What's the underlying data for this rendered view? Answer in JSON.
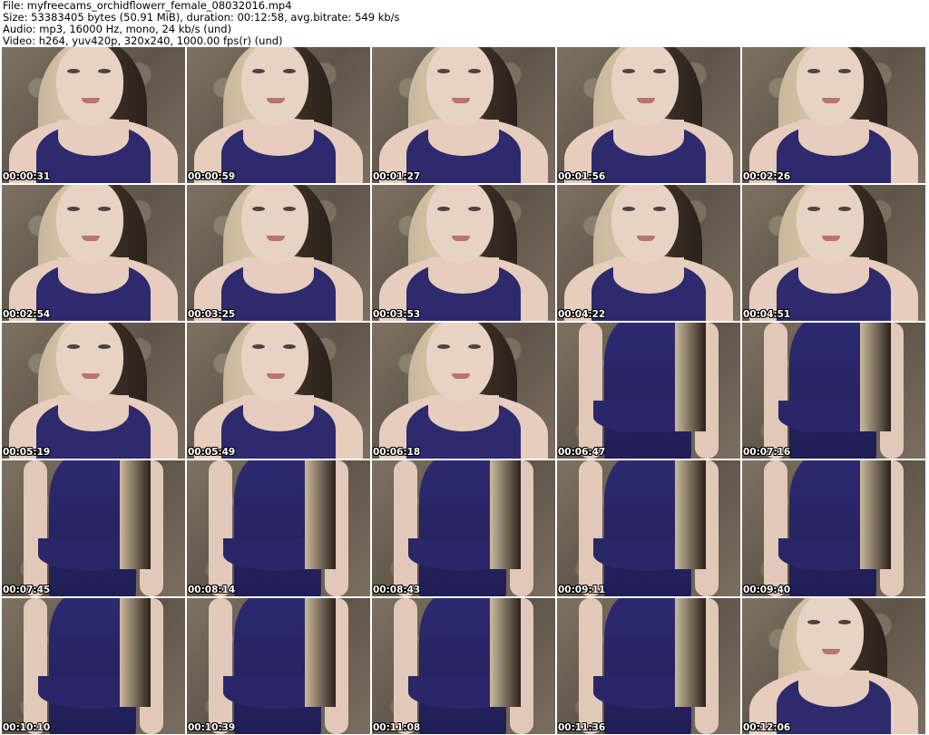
{
  "header": {
    "file_line": "File: myfreecams_orchidflowerr_female_08032016.mp4",
    "size_line": "Size: 53383405 bytes (50.91 MiB), duration: 00:12:58, avg.bitrate: 549 kb/s",
    "audio_line": "Audio: mp3, 16000 Hz, mono, 24 kb/s (und)",
    "video_line": "Video: h264, yuv420p, 320x240, 1000.00 fps(r) (und)"
  },
  "thumbnails": [
    {
      "timestamp": "00:00:31"
    },
    {
      "timestamp": "00:00:59"
    },
    {
      "timestamp": "00:01:27"
    },
    {
      "timestamp": "00:01:56"
    },
    {
      "timestamp": "00:02:26"
    },
    {
      "timestamp": "00:02:54"
    },
    {
      "timestamp": "00:03:25"
    },
    {
      "timestamp": "00:03:53"
    },
    {
      "timestamp": "00:04:22"
    },
    {
      "timestamp": "00:04:51"
    },
    {
      "timestamp": "00:05:19"
    },
    {
      "timestamp": "00:05:49"
    },
    {
      "timestamp": "00:06:18"
    },
    {
      "timestamp": "00:06:47"
    },
    {
      "timestamp": "00:07:16"
    },
    {
      "timestamp": "00:07:45"
    },
    {
      "timestamp": "00:08:14"
    },
    {
      "timestamp": "00:08:43"
    },
    {
      "timestamp": "00:09:11"
    },
    {
      "timestamp": "00:09:40"
    },
    {
      "timestamp": "00:10:10"
    },
    {
      "timestamp": "00:10:39"
    },
    {
      "timestamp": "00:11:08"
    },
    {
      "timestamp": "00:11:36"
    },
    {
      "timestamp": "00:12:06"
    }
  ]
}
